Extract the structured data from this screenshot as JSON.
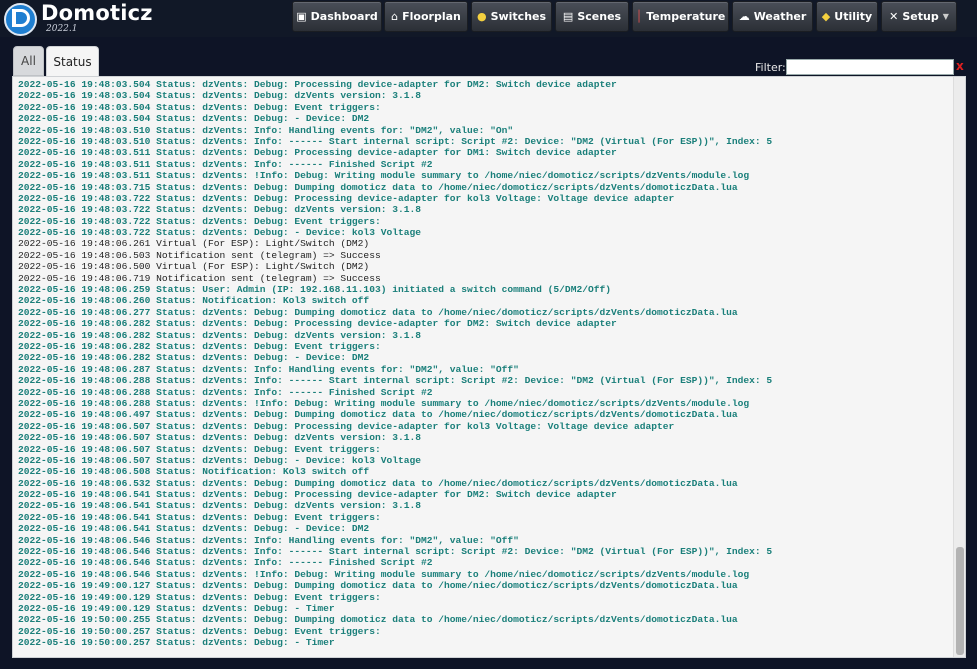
{
  "app": {
    "name": "Domoticz",
    "version": "2022.1"
  },
  "nav": [
    {
      "label": "Dashboard",
      "icon": "dashboard-icon",
      "glyph": "▣"
    },
    {
      "label": "Floorplan",
      "icon": "floorplan-icon",
      "glyph": "⌂"
    },
    {
      "label": "Switches",
      "icon": "lightbulb-icon",
      "glyph": "●"
    },
    {
      "label": "Scenes",
      "icon": "scenes-icon",
      "glyph": "▤"
    },
    {
      "label": "Temperature",
      "icon": "thermometer-icon",
      "glyph": "│"
    },
    {
      "label": "Weather",
      "icon": "weather-icon",
      "glyph": "☁"
    },
    {
      "label": "Utility",
      "icon": "utility-icon",
      "glyph": "◆"
    },
    {
      "label": "Setup",
      "icon": "setup-icon",
      "glyph": "✕"
    }
  ],
  "tabs": {
    "all": "All",
    "status": "Status"
  },
  "filter": {
    "label": "Filter:",
    "value": "",
    "clear": "x"
  },
  "log": [
    {
      "t": "2022-05-16 19:48:03.504 Status: dzVents: Debug: Processing device-adapter for DM2: Switch device adapter",
      "c": "status"
    },
    {
      "t": "2022-05-16 19:48:03.504 Status: dzVents: Debug: dzVents version: 3.1.8",
      "c": "status"
    },
    {
      "t": "2022-05-16 19:48:03.504 Status: dzVents: Debug: Event triggers:",
      "c": "status"
    },
    {
      "t": "2022-05-16 19:48:03.504 Status: dzVents: Debug: - Device: DM2",
      "c": "status"
    },
    {
      "t": "2022-05-16 19:48:03.510 Status: dzVents: Info: Handling events for: \"DM2\", value: \"On\"",
      "c": "status"
    },
    {
      "t": "2022-05-16 19:48:03.510 Status: dzVents: Info: ------ Start internal script: Script #2: Device: \"DM2 (Virtual (For ESP))\", Index: 5",
      "c": "status"
    },
    {
      "t": "2022-05-16 19:48:03.511 Status: dzVents: Debug: Processing device-adapter for DM1: Switch device adapter",
      "c": "status"
    },
    {
      "t": "2022-05-16 19:48:03.511 Status: dzVents: Info: ------ Finished Script #2",
      "c": "status"
    },
    {
      "t": "2022-05-16 19:48:03.511 Status: dzVents: !Info: Debug: Writing module summary to /home/niec/domoticz/scripts/dzVents/module.log",
      "c": "status"
    },
    {
      "t": "2022-05-16 19:48:03.715 Status: dzVents: Debug: Dumping domoticz data to /home/niec/domoticz/scripts/dzVents/domoticzData.lua",
      "c": "status"
    },
    {
      "t": "2022-05-16 19:48:03.722 Status: dzVents: Debug: Processing device-adapter for kol3 Voltage: Voltage device adapter",
      "c": "status"
    },
    {
      "t": "2022-05-16 19:48:03.722 Status: dzVents: Debug: dzVents version: 3.1.8",
      "c": "status"
    },
    {
      "t": "2022-05-16 19:48:03.722 Status: dzVents: Debug: Event triggers:",
      "c": "status"
    },
    {
      "t": "2022-05-16 19:48:03.722 Status: dzVents: Debug: - Device: kol3 Voltage",
      "c": "status"
    },
    {
      "t": "2022-05-16 19:48:06.261 Virtual (For ESP): Light/Switch (DM2)",
      "c": "plain"
    },
    {
      "t": "2022-05-16 19:48:06.503 Notification sent (telegram) => Success",
      "c": "plain"
    },
    {
      "t": "2022-05-16 19:48:06.500 Virtual (For ESP): Light/Switch (DM2)",
      "c": "plain"
    },
    {
      "t": "2022-05-16 19:48:06.719 Notification sent (telegram) => Success",
      "c": "plain"
    },
    {
      "t": "2022-05-16 19:48:06.259 Status: User: Admin (IP: 192.168.11.103) initiated a switch command (5/DM2/Off)",
      "c": "status"
    },
    {
      "t": "2022-05-16 19:48:06.260 Status: Notification: Kol3 switch off",
      "c": "status"
    },
    {
      "t": "2022-05-16 19:48:06.277 Status: dzVents: Debug: Dumping domoticz data to /home/niec/domoticz/scripts/dzVents/domoticzData.lua",
      "c": "status"
    },
    {
      "t": "2022-05-16 19:48:06.282 Status: dzVents: Debug: Processing device-adapter for DM2: Switch device adapter",
      "c": "status"
    },
    {
      "t": "2022-05-16 19:48:06.282 Status: dzVents: Debug: dzVents version: 3.1.8",
      "c": "status"
    },
    {
      "t": "2022-05-16 19:48:06.282 Status: dzVents: Debug: Event triggers:",
      "c": "status"
    },
    {
      "t": "2022-05-16 19:48:06.282 Status: dzVents: Debug: - Device: DM2",
      "c": "status"
    },
    {
      "t": "2022-05-16 19:48:06.287 Status: dzVents: Info: Handling events for: \"DM2\", value: \"Off\"",
      "c": "status"
    },
    {
      "t": "2022-05-16 19:48:06.288 Status: dzVents: Info: ------ Start internal script: Script #2: Device: \"DM2 (Virtual (For ESP))\", Index: 5",
      "c": "status"
    },
    {
      "t": "2022-05-16 19:48:06.288 Status: dzVents: Info: ------ Finished Script #2",
      "c": "status"
    },
    {
      "t": "2022-05-16 19:48:06.288 Status: dzVents: !Info: Debug: Writing module summary to /home/niec/domoticz/scripts/dzVents/module.log",
      "c": "status"
    },
    {
      "t": "2022-05-16 19:48:06.497 Status: dzVents: Debug: Dumping domoticz data to /home/niec/domoticz/scripts/dzVents/domoticzData.lua",
      "c": "status"
    },
    {
      "t": "2022-05-16 19:48:06.507 Status: dzVents: Debug: Processing device-adapter for kol3 Voltage: Voltage device adapter",
      "c": "status"
    },
    {
      "t": "2022-05-16 19:48:06.507 Status: dzVents: Debug: dzVents version: 3.1.8",
      "c": "status"
    },
    {
      "t": "2022-05-16 19:48:06.507 Status: dzVents: Debug: Event triggers:",
      "c": "status"
    },
    {
      "t": "2022-05-16 19:48:06.507 Status: dzVents: Debug: - Device: kol3 Voltage",
      "c": "status"
    },
    {
      "t": "2022-05-16 19:48:06.508 Status: Notification: Kol3 switch off",
      "c": "status"
    },
    {
      "t": "2022-05-16 19:48:06.532 Status: dzVents: Debug: Dumping domoticz data to /home/niec/domoticz/scripts/dzVents/domoticzData.lua",
      "c": "status"
    },
    {
      "t": "2022-05-16 19:48:06.541 Status: dzVents: Debug: Processing device-adapter for DM2: Switch device adapter",
      "c": "status"
    },
    {
      "t": "2022-05-16 19:48:06.541 Status: dzVents: Debug: dzVents version: 3.1.8",
      "c": "status"
    },
    {
      "t": "2022-05-16 19:48:06.541 Status: dzVents: Debug: Event triggers:",
      "c": "status"
    },
    {
      "t": "2022-05-16 19:48:06.541 Status: dzVents: Debug: - Device: DM2",
      "c": "status"
    },
    {
      "t": "2022-05-16 19:48:06.546 Status: dzVents: Info: Handling events for: \"DM2\", value: \"Off\"",
      "c": "status"
    },
    {
      "t": "2022-05-16 19:48:06.546 Status: dzVents: Info: ------ Start internal script: Script #2: Device: \"DM2 (Virtual (For ESP))\", Index: 5",
      "c": "status"
    },
    {
      "t": "2022-05-16 19:48:06.546 Status: dzVents: Info: ------ Finished Script #2",
      "c": "status"
    },
    {
      "t": "2022-05-16 19:48:06.546 Status: dzVents: !Info: Debug: Writing module summary to /home/niec/domoticz/scripts/dzVents/module.log",
      "c": "status"
    },
    {
      "t": "2022-05-16 19:49:00.127 Status: dzVents: Debug: Dumping domoticz data to /home/niec/domoticz/scripts/dzVents/domoticzData.lua",
      "c": "status"
    },
    {
      "t": "2022-05-16 19:49:00.129 Status: dzVents: Debug: Event triggers:",
      "c": "status"
    },
    {
      "t": "2022-05-16 19:49:00.129 Status: dzVents: Debug: - Timer",
      "c": "status"
    },
    {
      "t": "2022-05-16 19:50:00.255 Status: dzVents: Debug: Dumping domoticz data to /home/niec/domoticz/scripts/dzVents/domoticzData.lua",
      "c": "status"
    },
    {
      "t": "2022-05-16 19:50:00.257 Status: dzVents: Debug: Event triggers:",
      "c": "status"
    },
    {
      "t": "2022-05-16 19:50:00.257 Status: dzVents: Debug: - Timer",
      "c": "status"
    }
  ]
}
